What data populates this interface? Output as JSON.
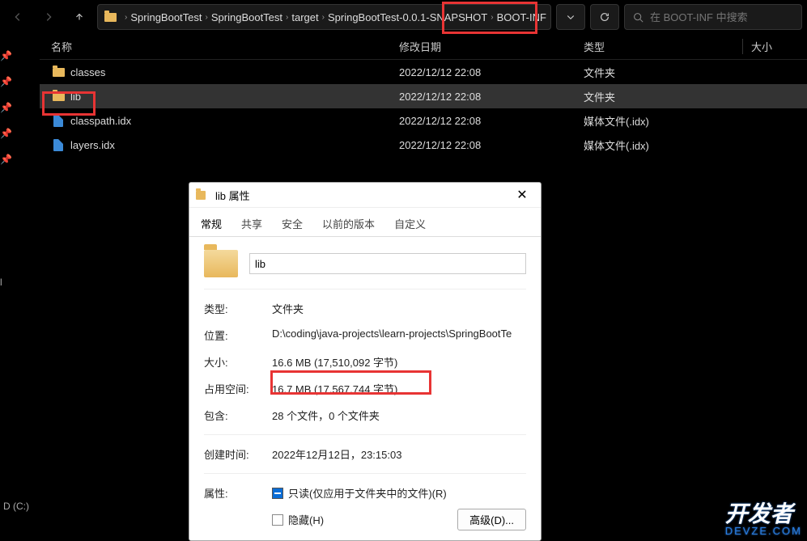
{
  "breadcrumb": {
    "items": [
      "SpringBootTest",
      "SpringBootTest",
      "target",
      "SpringBootTest-0.0.1-SNAPSHOT",
      "BOOT-INF"
    ]
  },
  "search": {
    "placeholder": "在 BOOT-INF 中搜索"
  },
  "columns": {
    "name": "名称",
    "date": "修改日期",
    "type": "类型",
    "size": "大小"
  },
  "files": [
    {
      "icon": "folder",
      "name": "classes",
      "date": "2022/12/12 22:08",
      "type": "文件夹"
    },
    {
      "icon": "folder",
      "name": "lib",
      "date": "2022/12/12 22:08",
      "type": "文件夹",
      "selected": true
    },
    {
      "icon": "doc",
      "name": "classpath.idx",
      "date": "2022/12/12 22:08",
      "type": "媒体文件(.idx)"
    },
    {
      "icon": "doc",
      "name": "layers.idx",
      "date": "2022/12/12 22:08",
      "type": "媒体文件(.idx)"
    }
  ],
  "sidebar": {
    "personal": "rsonal",
    "drive": "D (C:)"
  },
  "dialog": {
    "title": "lib 属性",
    "tabs": [
      "常规",
      "共享",
      "安全",
      "以前的版本",
      "自定义"
    ],
    "name_value": "lib",
    "rows": {
      "type_label": "类型:",
      "type_value": "文件夹",
      "loc_label": "位置:",
      "loc_value": "D:\\coding\\java-projects\\learn-projects\\SpringBootTe",
      "size_label": "大小:",
      "size_value": "16.6 MB (17,510,092 字节)",
      "disk_label": "占用空间:",
      "disk_value": "16.7 MB (17,567,744 字节)",
      "contains_label": "包含:",
      "contains_value": "28 个文件，0 个文件夹",
      "created_label": "创建时间:",
      "created_value": "2022年12月12日，23:15:03",
      "attr_label": "属性:",
      "readonly_text": "只读(仅应用于文件夹中的文件)(R)",
      "hidden_text": "隐藏(H)",
      "advanced": "高级(D)..."
    }
  },
  "watermark": {
    "big": "开发者",
    "small": "DEVZE.COM"
  }
}
